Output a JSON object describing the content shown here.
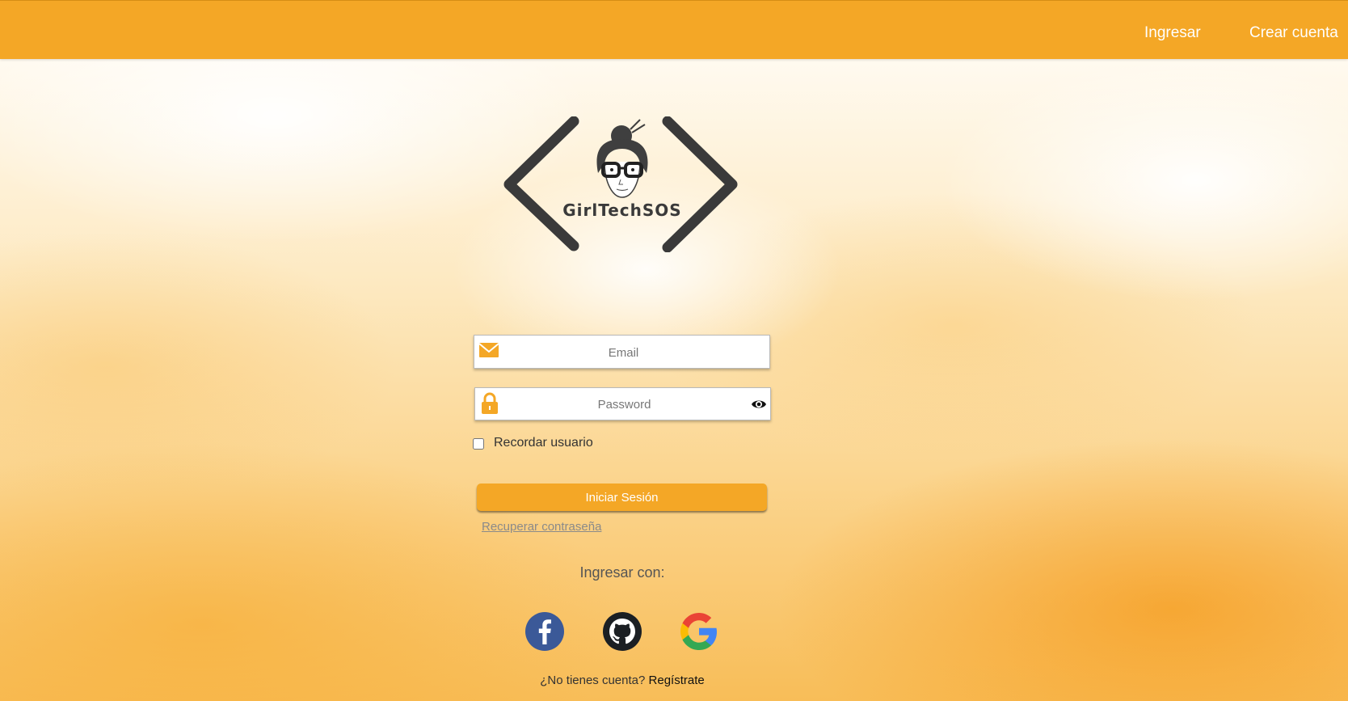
{
  "nav": {
    "login_label": "Ingresar",
    "register_label": "Crear cuenta"
  },
  "logo": {
    "text": "GirlTechSOS"
  },
  "form": {
    "email_placeholder": "Email",
    "email_value": "",
    "password_placeholder": "Password",
    "password_value": "",
    "remember_label": "Recordar usuario",
    "remember_checked": false,
    "login_button_label": "Iniciar Sesión",
    "forgot_password_label": "Recuperar contraseña"
  },
  "social": {
    "title": "Ingresar con:",
    "providers": [
      {
        "name": "facebook",
        "icon": "facebook-icon"
      },
      {
        "name": "github",
        "icon": "github-icon"
      },
      {
        "name": "google",
        "icon": "google-icon"
      }
    ]
  },
  "signup": {
    "prompt": "¿No tienes cuenta?",
    "link_label": "Regístrate"
  },
  "colors": {
    "accent": "#f4a726",
    "logo_dark": "#3a3a3a"
  }
}
